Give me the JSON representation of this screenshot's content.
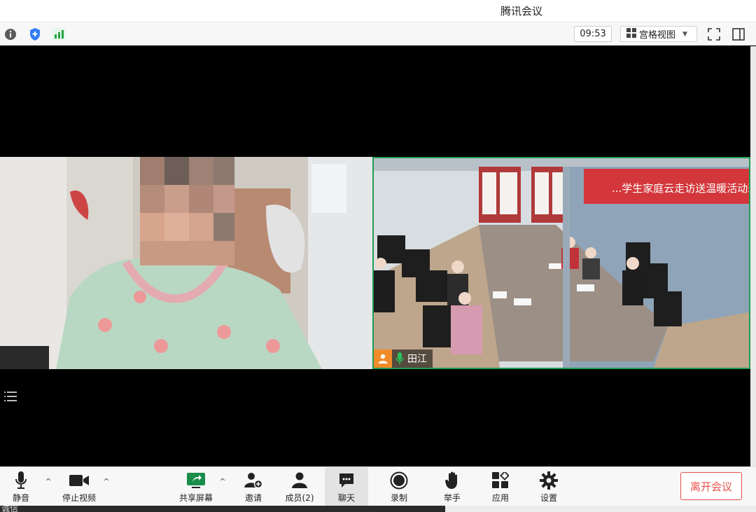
{
  "window": {
    "title": "腾讯会议"
  },
  "infobar": {
    "icons": [
      "info-icon",
      "shield-icon",
      "signal-icon"
    ],
    "time": "09:53",
    "view_label": "宫格视图",
    "right_icons": [
      "fullscreen-icon",
      "side-panel-icon"
    ]
  },
  "stage": {
    "participants": [
      {
        "name": ""
      },
      {
        "name": "田江",
        "mic": "on"
      }
    ],
    "banner_text": "...学生家庭云走访送温暖活动现场"
  },
  "toolbar": {
    "mute_label": "静音",
    "video_label": "停止视频",
    "share_label": "共享屏幕",
    "invite_label": "邀请",
    "members_label": "成员(2)",
    "chat_label": "聊天",
    "record_label": "录制",
    "raise_hand_label": "举手",
    "apps_label": "应用",
    "settings_label": "设置",
    "leave_label": "离开会议"
  },
  "bottom": {
    "partial_text": "诚信"
  },
  "colors": {
    "accent_green": "#1f9d55",
    "leave_red": "#e8504c",
    "share_green": "#1a8d4a"
  }
}
